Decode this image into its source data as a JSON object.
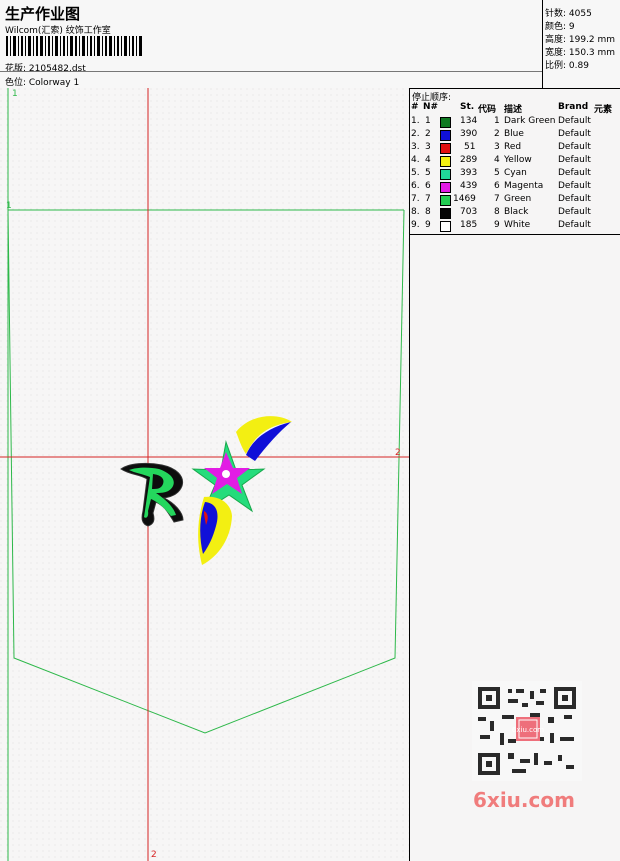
{
  "header": {
    "title": "生产作业图",
    "company": "Wilcom(汇索) 纹饰工作室",
    "file": "花版: 2105482.dst",
    "colorway": "色位: Colorway 1"
  },
  "stats": {
    "stitches": "针数: 4055",
    "colors": "颜色: 9",
    "height": "高度: 199.2 mm",
    "width": "宽度: 150.3 mm",
    "scale": "比例: 0.89"
  },
  "table": {
    "stop_label": "停止顺序:",
    "headers": [
      "#",
      "N#",
      "St.",
      "代码",
      "描述",
      "Brand",
      "元素"
    ],
    "rows": [
      {
        "num": "1.",
        "n": "1",
        "color": "#0f7a22",
        "st": "134",
        "code": "1",
        "desc": "Dark Green",
        "brand": "Default"
      },
      {
        "num": "2.",
        "n": "2",
        "color": "#1010d8",
        "st": "390",
        "code": "2",
        "desc": "Blue",
        "brand": "Default"
      },
      {
        "num": "3.",
        "n": "3",
        "color": "#e21010",
        "st": "51",
        "code": "3",
        "desc": "Red",
        "brand": "Default"
      },
      {
        "num": "4.",
        "n": "4",
        "color": "#f3ef12",
        "st": "289",
        "code": "4",
        "desc": "Yellow",
        "brand": "Default"
      },
      {
        "num": "5.",
        "n": "5",
        "color": "#20d99a",
        "st": "393",
        "code": "5",
        "desc": "Cyan",
        "brand": "Default"
      },
      {
        "num": "6.",
        "n": "6",
        "color": "#e21ce4",
        "st": "439",
        "code": "6",
        "desc": "Magenta",
        "brand": "Default"
      },
      {
        "num": "7.",
        "n": "7",
        "color": "#22ce52",
        "st": "1469",
        "code": "7",
        "desc": "Green",
        "brand": "Default"
      },
      {
        "num": "8.",
        "n": "8",
        "color": "#050505",
        "st": "703",
        "code": "8",
        "desc": "Black",
        "brand": "Default"
      },
      {
        "num": "9.",
        "n": "9",
        "color": "#ffffff",
        "st": "185",
        "code": "9",
        "desc": "White",
        "brand": "Default"
      }
    ]
  },
  "markers": {
    "corner_top": "1",
    "corner_left": "1",
    "center_right": "2",
    "center_bottom": "2"
  },
  "watermark": {
    "qr_text": "6xiu.com",
    "site": "6xiu.com"
  }
}
